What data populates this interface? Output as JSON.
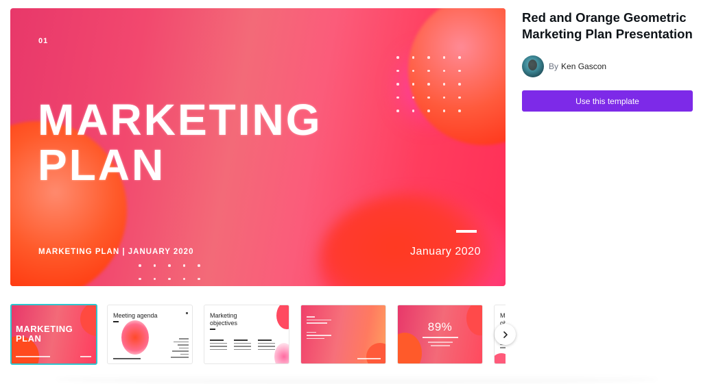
{
  "template": {
    "title": "Red and Orange Geometric Marketing Plan Presentation",
    "by_label": "By",
    "author_name": "Ken Gascon",
    "cta_label": "Use this template"
  },
  "preview": {
    "slide_number": "01",
    "title_line1": "MARKETING",
    "title_line2": "PLAN",
    "subtitle": "MARKETING PLAN | JANUARY 2020",
    "date": "January 2020"
  },
  "thumbnails": {
    "t1_title_line1": "MARKETING",
    "t1_title_line2": "PLAN",
    "t2_heading": "Meeting agenda",
    "t3_heading_line1": "Marketing",
    "t3_heading_line2": "objectives",
    "t5_value": "89%",
    "t6_heading_line1": "Mar",
    "t6_heading_line2": "obje"
  },
  "colors": {
    "accent": "#7d2ae8",
    "active_thumb_border": "#2ec5ce"
  },
  "icons": {
    "next": "chevron-right-icon"
  }
}
